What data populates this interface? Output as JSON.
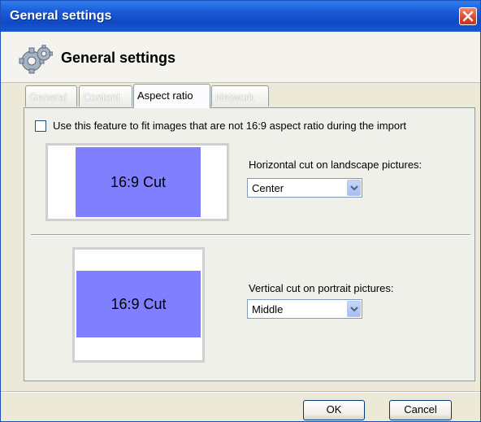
{
  "window": {
    "title": "General settings"
  },
  "header": {
    "title": "General settings",
    "icon": "gears-icon"
  },
  "tabs": [
    {
      "label": "General",
      "active": false
    },
    {
      "label": "Content",
      "active": false
    },
    {
      "label": "Aspect ratio",
      "active": true
    },
    {
      "label": "Network",
      "active": false
    }
  ],
  "aspect": {
    "checkbox_label": "Use this feature to fit images that are not 16:9 aspect ratio during the import",
    "checkbox_checked": false,
    "landscape": {
      "preview_label": "16:9 Cut",
      "field_label": "Horizontal cut on landscape pictures:",
      "value": "Center"
    },
    "portrait": {
      "preview_label": "16:9 Cut",
      "field_label": "Vertical cut on portrait pictures:",
      "value": "Middle"
    }
  },
  "buttons": {
    "ok": "OK",
    "cancel": "Cancel"
  },
  "colors": {
    "cut_fill": "#8080ff",
    "titlebar": "#1a5bd6",
    "close": "#d9472a"
  }
}
